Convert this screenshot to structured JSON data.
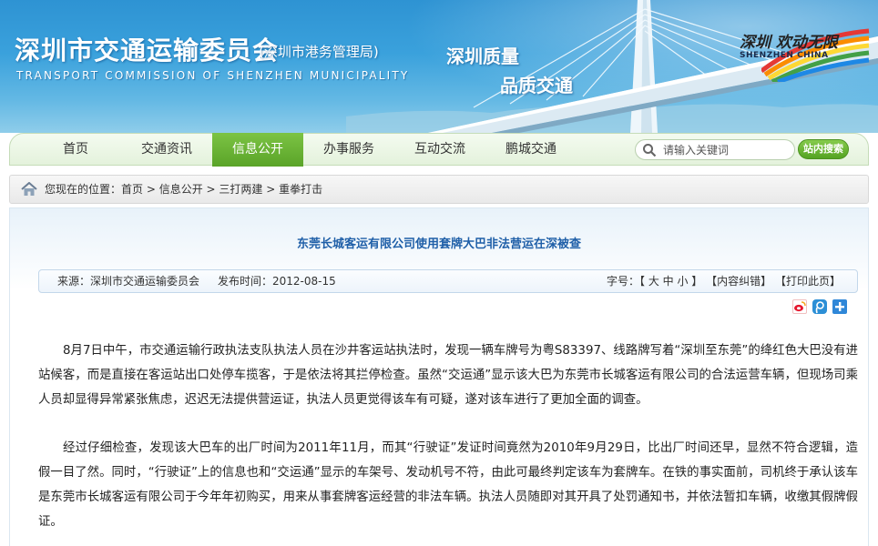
{
  "header": {
    "site_title": "深圳市交通运输委员会",
    "site_subtitle": "(深圳市港务管理局)",
    "site_title_en": "TRANSPORT COMMISSION OF SHENZHEN MUNICIPALITY",
    "slogan_line1": "深圳质量",
    "slogan_line2": "品质交通",
    "brand_cn": "深圳 欢动无限",
    "brand_en": "SHENZHEN CHINA"
  },
  "nav": {
    "items": [
      {
        "label": "首页"
      },
      {
        "label": "交通资讯"
      },
      {
        "label": "信息公开"
      },
      {
        "label": "办事服务"
      },
      {
        "label": "互动交流"
      },
      {
        "label": "鹏城交通"
      }
    ],
    "active_index": 2,
    "search_placeholder": "请输入关键词",
    "search_button": "站内搜索"
  },
  "breadcrumb": {
    "prefix": "您现在的位置：",
    "items": [
      "首页",
      "信息公开",
      "三打两建",
      "重拳打击"
    ],
    "separator": " > "
  },
  "article": {
    "title": "东莞长城客运有限公司使用套牌大巴非法营运在深被查",
    "source": "来源：深圳市交通运输委员会",
    "publish_time": "发布时间：2012-08-15",
    "font_label": "字号：",
    "font_size_links": "【 大 中 小 】",
    "correction_link": "【内容纠错】",
    "print_link": "【打印此页】",
    "paragraphs": [
      "8月7日中午，市交通运输行政执法支队执法人员在沙井客运站执法时，发现一辆车牌号为粤S83397、线路牌写着“深圳至东莞”的绛红色大巴没有进站候客，而是直接在客运站出口处停车揽客，于是依法将其拦停检查。虽然“交运通”显示该大巴为东莞市长城客运有限公司的合法运营车辆，但现场司乘人员却显得异常紧张焦虑，迟迟无法提供营运证，执法人员更觉得该车有可疑，遂对该车进行了更加全面的调查。",
      "经过仔细检查，发现该大巴车的出厂时间为2011年11月，而其“行驶证”发证时间竟然为2010年9月29日，比出厂时间还早，显然不符合逻辑，造假一目了然。同时，“行驶证”上的信息也和“交运通”显示的车架号、发动机号不符，由此可最终判定该车为套牌车。在铁的事实面前，司机终于承认该车是东莞市长城客运有限公司于今年年初购买，用来从事套牌客运经营的非法车辆。执法人员随即对其开具了处罚通知书，并依法暂扣车辆，收缴其假牌假证。"
    ]
  },
  "colors": {
    "banner_blue": "#2e93d3",
    "nav_active_green": "#5aa428",
    "title_blue": "#1f5fa8"
  }
}
